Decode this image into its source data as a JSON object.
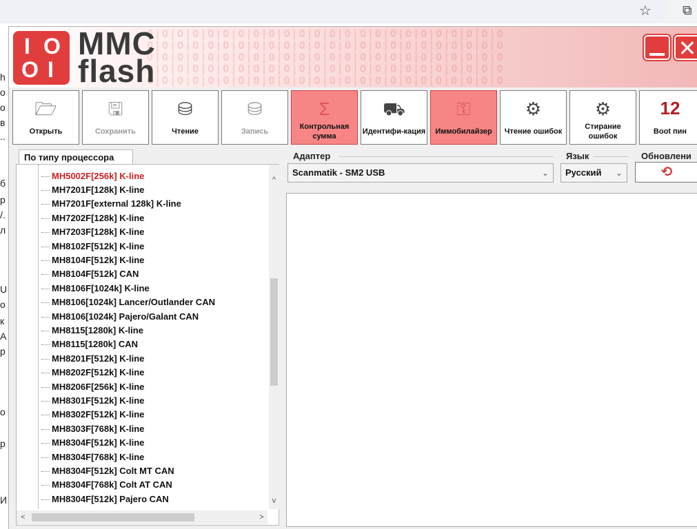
{
  "browser": {
    "star_icon": "☆",
    "extensions_icon": "⧉"
  },
  "background_page": {
    "fragments": [
      "h",
      "o",
      "о",
      "в",
      "..",
      "б",
      "р",
      "/.",
      "л",
      "U",
      "о",
      "к",
      "А",
      "р",
      "о",
      "р",
      "И"
    ]
  },
  "app": {
    "logo_digits": [
      "I",
      "O",
      "O",
      "I"
    ],
    "title_line1": "MMC",
    "title_line2": "flash",
    "binary_pattern": "O|O|O|O|O|O|O|O|O|O|O|O|O|O|O|O|O|O|O|O|O|O|O|O",
    "window_controls": {
      "minimize": "",
      "close": "✕"
    }
  },
  "toolbar": {
    "open": {
      "label": "Открыть",
      "icon": "🗁"
    },
    "save": {
      "label": "Сохранить",
      "icon": "🖫"
    },
    "read": {
      "label": "Чтение",
      "icon": "⛁"
    },
    "write": {
      "label": "Запись",
      "icon": "⛁"
    },
    "checksum": {
      "label": "Контрольная сумма",
      "icon": "Σ"
    },
    "identify": {
      "label": "Идентифи-кация",
      "icon": "⛟"
    },
    "immobilizer": {
      "label": "Иммобилайзер",
      "icon": "⚿"
    },
    "read_errors": {
      "label": "Чтение ошибок",
      "icon": "⚙"
    },
    "clear_errors": {
      "label": "Стирание ошибок",
      "icon": "⚙"
    },
    "boot_pin": {
      "label": "Boot пин",
      "number": "12"
    }
  },
  "left_panel": {
    "tab_label": "По типу процессора",
    "items": [
      "MH5002F[256k] K-line",
      "MH7201F[128k] K-line",
      "MH7201F[external 128k] K-line",
      "MH7202F[128k] K-line",
      "MH7203F[128k] K-line",
      "MH8102F[512k] K-line",
      "MH8104F[512k] K-line",
      "MH8104F[512k] CAN",
      "MH8106F[1024k] K-line",
      "MH8106[1024k] Lancer/Outlander CAN",
      "MH8106[1024k] Pajero/Galant CAN",
      "MH8115[1280k] K-line",
      "MH8115[1280k] CAN",
      "MH8201F[512k] K-line",
      "MH8202F[512k] K-line",
      "MH8206F[256k] K-line",
      "MH8301F[512k] K-line",
      "MH8302F[512k] K-line",
      "MH8303F[768k] K-line",
      "MH8304F[512k] K-line",
      "MH8304F[768k] K-line",
      "MH8304F[512k] Colt MT CAN",
      "MH8304F[768k] Colt AT CAN",
      "MH8304F[512k] Pajero CAN"
    ],
    "selected_index": 0,
    "scroll_up": "^",
    "scroll_down": "v",
    "scroll_left": "<",
    "scroll_right": ">"
  },
  "adapter": {
    "label": "Адаптер",
    "value": "Scanmatik - SM2 USB"
  },
  "language": {
    "label": "Язык",
    "value": "Русский"
  },
  "update": {
    "label": "Обновлени",
    "icon": "⟲"
  },
  "colors": {
    "accent_red": "#e23d3d",
    "active_button": "#f78585",
    "selected_item": "#cc2222"
  }
}
